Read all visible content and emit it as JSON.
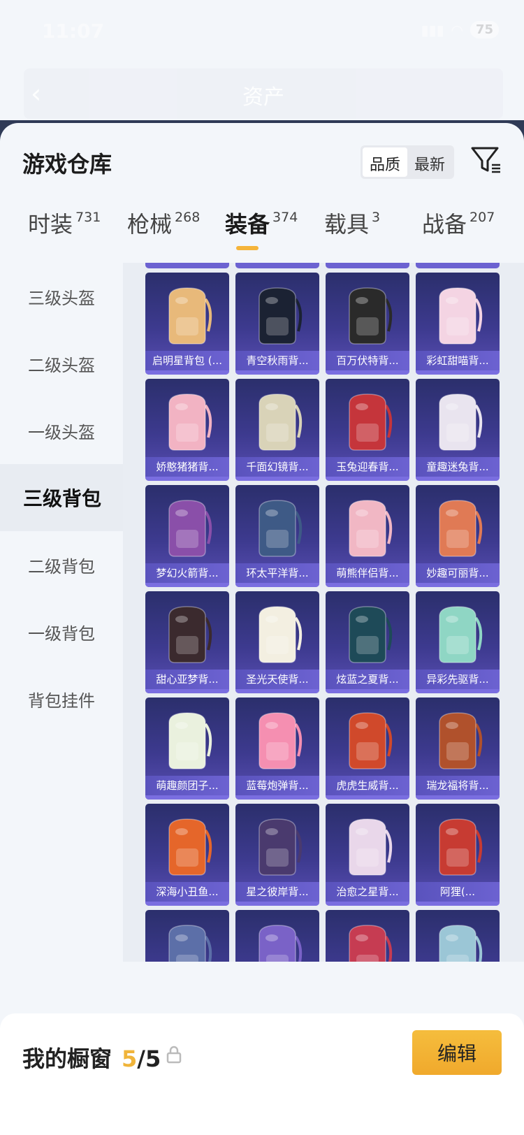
{
  "status": {
    "time": "11:07",
    "battery": "75"
  },
  "nav": {
    "title": "资产"
  },
  "header": {
    "title": "游戏仓库",
    "sort_options": [
      "品质",
      "最新"
    ]
  },
  "tabs": [
    {
      "label": "时装",
      "count": "731"
    },
    {
      "label": "枪械",
      "count": "268"
    },
    {
      "label": "装备",
      "count": "374",
      "active": true
    },
    {
      "label": "载具",
      "count": "3"
    },
    {
      "label": "战备",
      "count": "207"
    }
  ],
  "side_menu": [
    {
      "label": "三级头盔"
    },
    {
      "label": "二级头盔"
    },
    {
      "label": "一级头盔"
    },
    {
      "label": "三级背包",
      "active": true
    },
    {
      "label": "二级背包"
    },
    {
      "label": "一级背包"
    },
    {
      "label": "背包挂件"
    }
  ],
  "items": [
    {
      "name": "启明星背包 (...",
      "color": "#e8b97a"
    },
    {
      "name": "青空秋雨背...",
      "color": "#1b2233"
    },
    {
      "name": "百万伏特背...",
      "color": "#2a2a2a"
    },
    {
      "name": "彩虹甜喵背...",
      "color": "#f4d4e3"
    },
    {
      "name": "娇憨猪猪背...",
      "color": "#f2b3c3"
    },
    {
      "name": "千面幻镜背...",
      "color": "#d9d3b8"
    },
    {
      "name": "玉兔迎春背...",
      "color": "#c5353b"
    },
    {
      "name": "童趣迷兔背...",
      "color": "#e9e4ef"
    },
    {
      "name": "梦幻火箭背...",
      "color": "#8a4fa9"
    },
    {
      "name": "环太平洋背...",
      "color": "#3e5a86"
    },
    {
      "name": "萌熊伴侣背...",
      "color": "#f1b7c4"
    },
    {
      "name": "妙趣可丽背...",
      "color": "#e07a55"
    },
    {
      "name": "甜心亚梦背...",
      "color": "#3b2a2e"
    },
    {
      "name": "圣光天使背...",
      "color": "#f3efe1"
    },
    {
      "name": "炫蓝之夏背...",
      "color": "#1e4a58"
    },
    {
      "name": "异彩先驱背...",
      "color": "#8fd6c4"
    },
    {
      "name": "萌趣颜团子...",
      "color": "#eaf1de"
    },
    {
      "name": "蓝莓炮弹背...",
      "color": "#f58fb1"
    },
    {
      "name": "虎虎生威背...",
      "color": "#d0492b"
    },
    {
      "name": "瑞龙福将背...",
      "color": "#b0512c"
    },
    {
      "name": "深海小丑鱼...",
      "color": "#e5662a"
    },
    {
      "name": "星之彼岸背...",
      "color": "#4a3a6e"
    },
    {
      "name": "治愈之星背...",
      "color": "#e9d7ea"
    },
    {
      "name": "阿狸(...",
      "color": "#c73b32"
    },
    {
      "name": "",
      "color": "#5c6fa8"
    },
    {
      "name": "",
      "color": "#7a62c7"
    },
    {
      "name": "",
      "color": "#c63c52"
    },
    {
      "name": "",
      "color": "#9bc6d6"
    }
  ],
  "bottom": {
    "label": "我的橱窗",
    "count": "5",
    "total": "/5",
    "edit_label": "编辑"
  },
  "colors": {
    "accent": "#f3b530",
    "card_top": "#2b2f6c",
    "card_bottom": "#5a4fb4"
  }
}
